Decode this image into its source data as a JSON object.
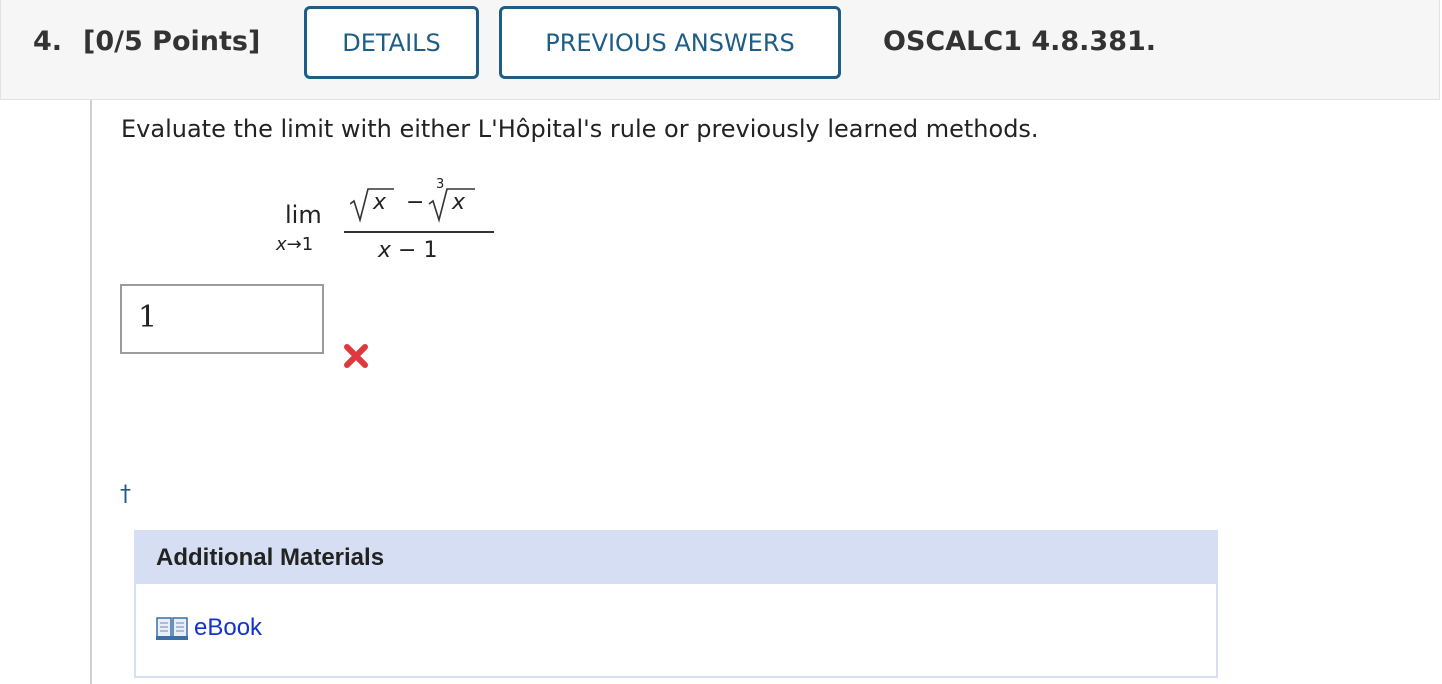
{
  "header": {
    "question_number": "4.",
    "points": "[0/5 Points]",
    "details_label": "DETAILS",
    "previous_answers_label": "PREVIOUS ANSWERS",
    "source_code": "OSCALC1 4.8.381."
  },
  "question": {
    "prompt": "Evaluate the limit with either L'Hôpital's rule or previously learned methods.",
    "limit": {
      "lim_word": "lim",
      "lim_variable": "x",
      "lim_arrow": "→",
      "lim_target": "1",
      "numerator_left": "x",
      "numerator_minus": "−",
      "cube_root_index": "3",
      "numerator_right": "x",
      "denominator_var": "x",
      "denominator_rest": " − 1"
    },
    "answer_value": "1",
    "status": "incorrect",
    "footnote_marker": "†"
  },
  "materials": {
    "title": "Additional Materials",
    "items": [
      {
        "label": "eBook",
        "icon": "book-icon"
      }
    ]
  },
  "colors": {
    "accent": "#1d5d86",
    "header_bg": "#f6f6f6",
    "materials_header_bg": "#d6def3",
    "link": "#1133cc",
    "error": "#e0383e"
  }
}
